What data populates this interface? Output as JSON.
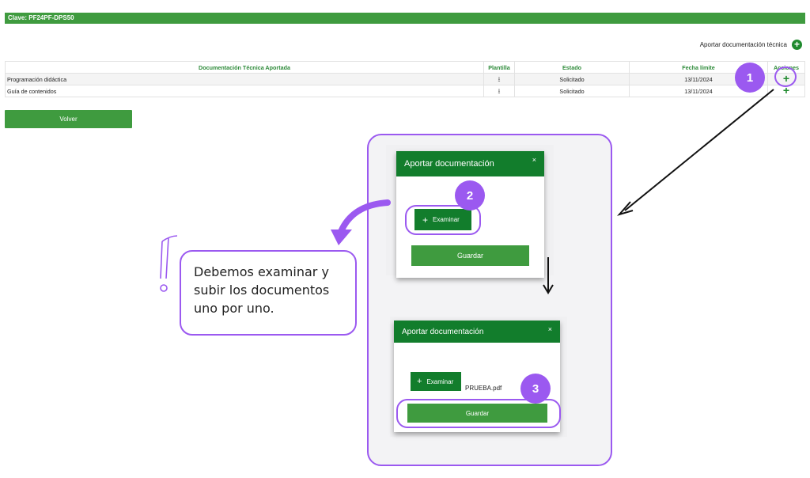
{
  "header": {
    "clave": "Clave: PF24PF-DPS50"
  },
  "aportar": {
    "label": "Aportar documentación técnica",
    "icon": "plus-circle-icon"
  },
  "table": {
    "headers": [
      "Documentación Técnica Aportada",
      "Plantilla",
      "Estado",
      "Fecha límite",
      "Acciones"
    ],
    "rows": [
      {
        "doc": "Programación didáctica",
        "plantilla_icon": "download-icon",
        "estado": "Solicitado",
        "fecha": "13/11/2024",
        "accion_icon": "plus-icon"
      },
      {
        "doc": "Guía de contenidos",
        "plantilla_icon": "download-icon",
        "estado": "Solicitado",
        "fecha": "13/11/2024",
        "accion_icon": "plus-icon"
      }
    ]
  },
  "volver": {
    "label": "Volver"
  },
  "tutorial": {
    "dialog1": {
      "title": "Aportar documentación",
      "close": "×",
      "examinar": "Examinar",
      "examinar_plus": "+",
      "guardar": "Guardar"
    },
    "dialog2": {
      "title": "Aportar documentación",
      "close": "×",
      "examinar": "Examinar",
      "examinar_plus": "+",
      "filename": "PRUEBA.pdf",
      "guardar": "Guardar"
    },
    "badges": [
      "1",
      "2",
      "3"
    ],
    "callout": {
      "line1": "Debemos examinar y",
      "line2": "subir los documentos",
      "line3": "uno por uno."
    }
  },
  "colors": {
    "green": "#3f9b3f",
    "dark_green": "#127d2c",
    "purple": "#9b59f0"
  }
}
